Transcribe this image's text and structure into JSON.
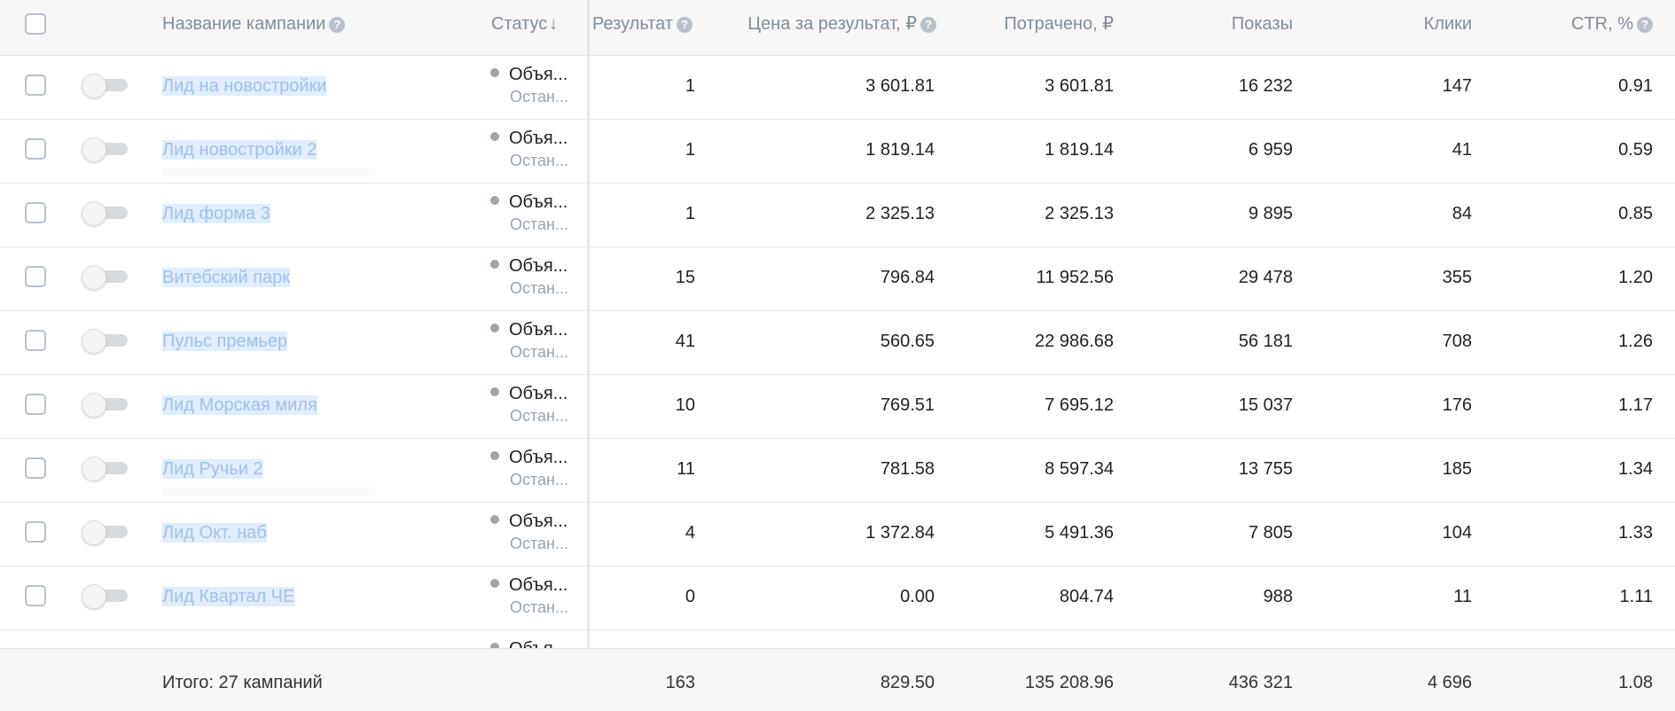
{
  "header": {
    "name": "Название кампании",
    "status": "Статус",
    "result": "Результат",
    "cost_per_result": "Цена за результат, ₽",
    "spent": "Потрачено, ₽",
    "impressions": "Показы",
    "clicks": "Клики",
    "ctr": "CTR, %"
  },
  "rows": [
    {
      "name": "Лид на новостройки",
      "status": "Объя...",
      "substatus": "Остан...",
      "result": "1",
      "cpr": "3 601.81",
      "spent": "3 601.81",
      "impressions": "16 232",
      "clicks": "147",
      "ctr": "0.91"
    },
    {
      "name": "Лид новостройки 2",
      "status": "Объя...",
      "substatus": "Остан...",
      "result": "1",
      "cpr": "1 819.14",
      "spent": "1 819.14",
      "impressions": "6 959",
      "clicks": "41",
      "ctr": "0.59"
    },
    {
      "name": "Лид форма 3",
      "status": "Объя...",
      "substatus": "Остан...",
      "result": "1",
      "cpr": "2 325.13",
      "spent": "2 325.13",
      "impressions": "9 895",
      "clicks": "84",
      "ctr": "0.85"
    },
    {
      "name": "Витебский парк",
      "status": "Объя...",
      "substatus": "Остан...",
      "result": "15",
      "cpr": "796.84",
      "spent": "11 952.56",
      "impressions": "29 478",
      "clicks": "355",
      "ctr": "1.20"
    },
    {
      "name": "Пульс премьер",
      "status": "Объя...",
      "substatus": "Остан...",
      "result": "41",
      "cpr": "560.65",
      "spent": "22 986.68",
      "impressions": "56 181",
      "clicks": "708",
      "ctr": "1.26"
    },
    {
      "name": "Лид Морская миля",
      "status": "Объя...",
      "substatus": "Остан...",
      "result": "10",
      "cpr": "769.51",
      "spent": "7 695.12",
      "impressions": "15 037",
      "clicks": "176",
      "ctr": "1.17"
    },
    {
      "name": "Лид Ручьи 2",
      "status": "Объя...",
      "substatus": "Остан...",
      "result": "11",
      "cpr": "781.58",
      "spent": "8 597.34",
      "impressions": "13 755",
      "clicks": "185",
      "ctr": "1.34"
    },
    {
      "name": "Лид Окт. наб",
      "status": "Объя...",
      "substatus": "Остан...",
      "result": "4",
      "cpr": "1 372.84",
      "spent": "5 491.36",
      "impressions": "7 805",
      "clicks": "104",
      "ctr": "1.33"
    },
    {
      "name": "Лид Квартал ЧЕ",
      "status": "Объя...",
      "substatus": "Остан...",
      "result": "0",
      "cpr": "0.00",
      "spent": "804.74",
      "impressions": "988",
      "clicks": "11",
      "ctr": "1.11"
    },
    {
      "name": "",
      "status": "Объя...",
      "substatus": "",
      "result": "",
      "cpr": "",
      "spent": "",
      "impressions": "",
      "clicks": "",
      "ctr": ""
    }
  ],
  "footer": {
    "total_label": "Итого: 27 кампаний",
    "result": "163",
    "cpr": "829.50",
    "spent": "135 208.96",
    "impressions": "436 321",
    "clicks": "4 696",
    "ctr": "1.08"
  }
}
